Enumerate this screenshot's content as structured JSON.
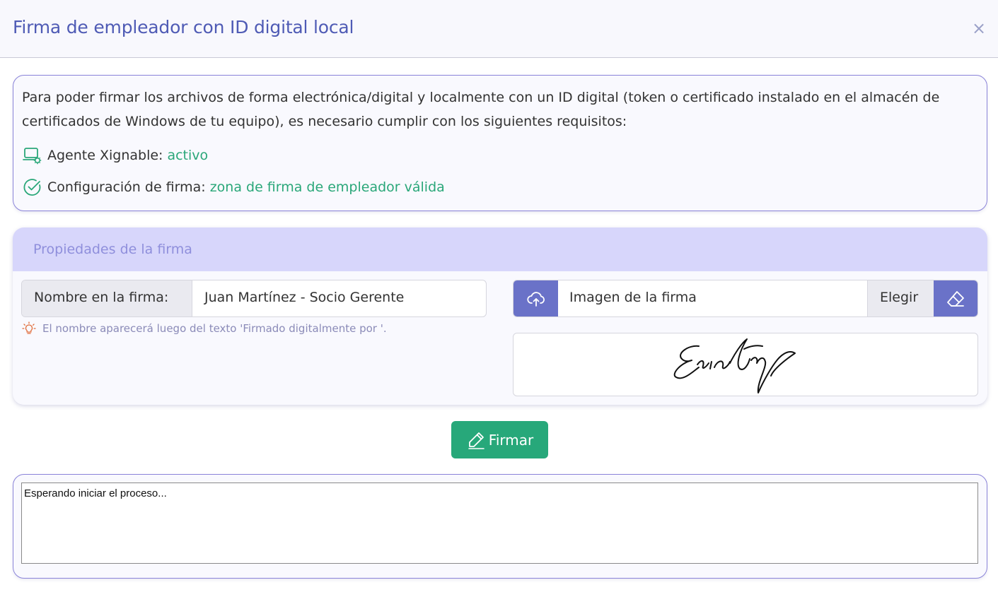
{
  "dialog": {
    "title": "Firma de empleador con ID digital local",
    "close_symbol": "×"
  },
  "requirements": {
    "intro": "Para poder firmar los archivos de forma electrónica/digital y localmente con un ID digital (token o certificado instalado en el almacén de certificados de Windows de tu equipo), es necesario cumplir con los siguientes requisitos:",
    "agent": {
      "label": "Agente Xignable:",
      "status": "activo",
      "icon": "laptop-gear-icon"
    },
    "config": {
      "label": "Configuración de firma:",
      "status": "zona de firma de empleador válida",
      "icon": "check-circle-icon"
    },
    "status_color": "#2aa779"
  },
  "properties": {
    "title": "Propiedades de la firma",
    "name_label": "Nombre en la firma:",
    "name_value": "Juan Martínez - Socio Gerente",
    "hint": "El nombre aparecerá luego del texto 'Firmado digitalmente por '.",
    "hint_icon": "lightbulb-icon",
    "image_placeholder": "Imagen de la firma",
    "choose_label": "Elegir",
    "upload_icon": "cloud-upload-icon",
    "erase_icon": "eraser-icon"
  },
  "actions": {
    "sign_label": "Firmar",
    "sign_icon": "pen-icon",
    "accent": "#27a87a"
  },
  "log": {
    "text": "Esperando iniciar el proceso..."
  },
  "colors": {
    "primary": "#6a72c8",
    "title": "#4f5bb5",
    "panel_header": "#d7d6fb"
  }
}
